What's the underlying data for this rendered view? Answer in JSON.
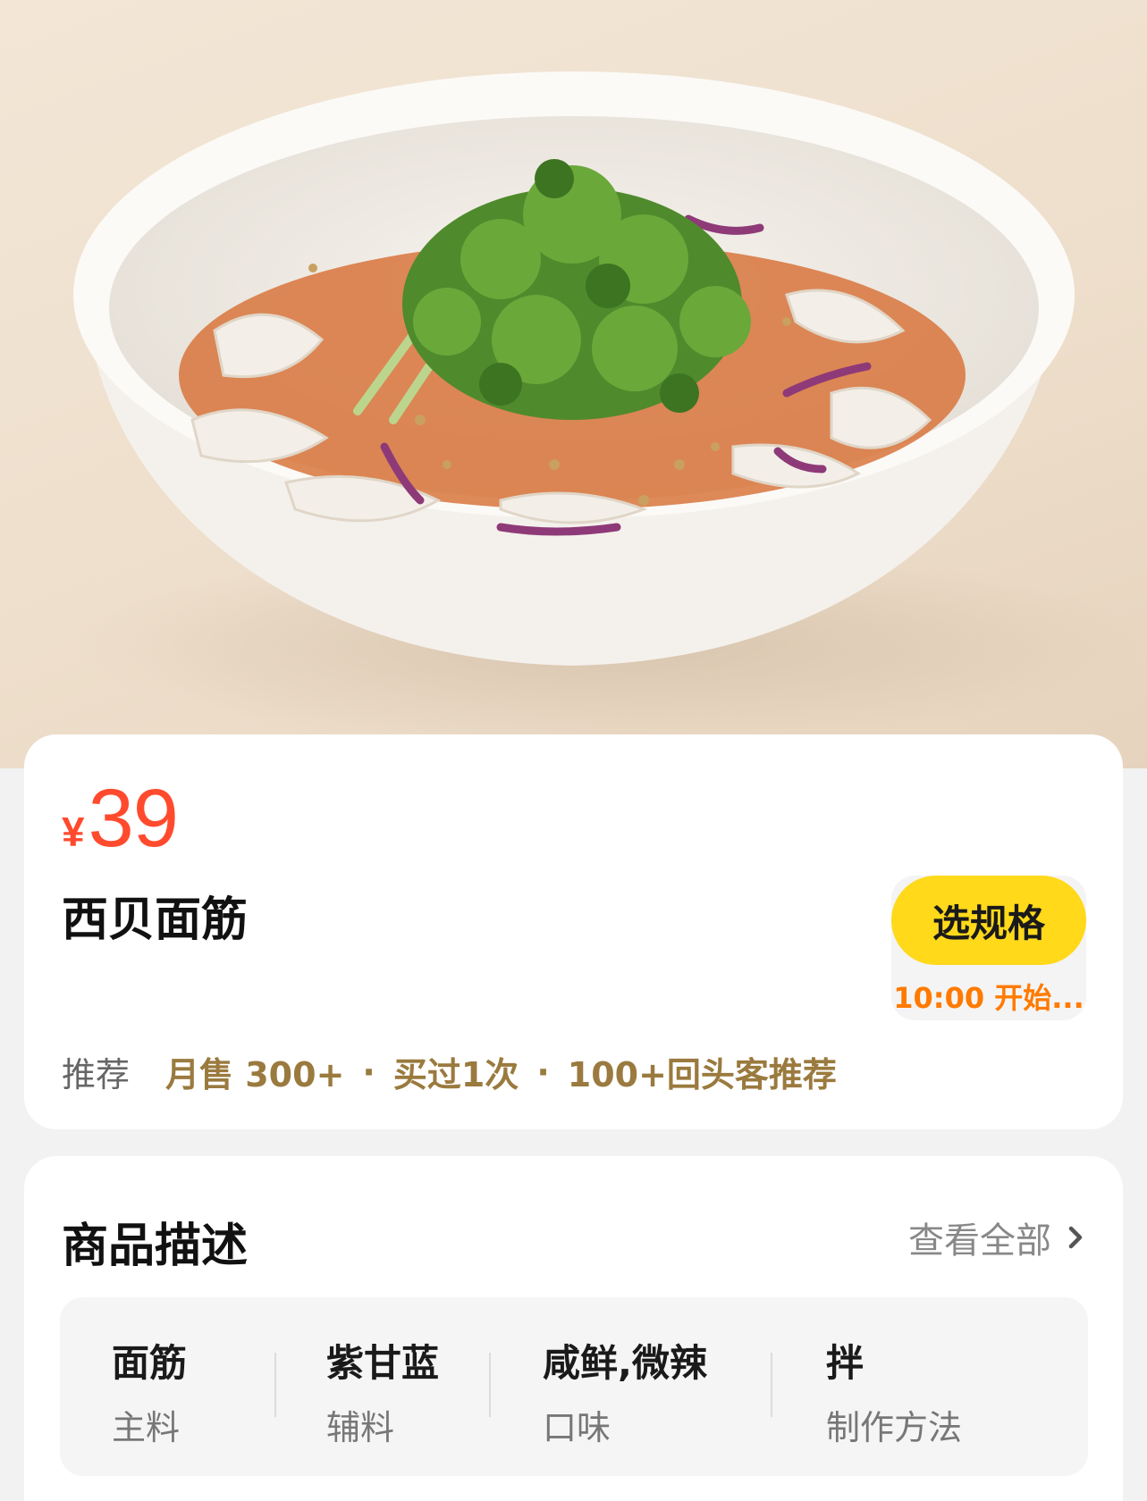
{
  "hero": {
    "image_desc": "dish photo"
  },
  "product": {
    "currency": "¥",
    "price": "39",
    "name": "西贝面筋",
    "spec_button": "选规格",
    "start_time": "10:00 开始...",
    "rec_label": "推荐",
    "rec_items": [
      "月售 300+",
      "买过1次",
      "100+回头客推荐"
    ]
  },
  "description": {
    "title": "商品描述",
    "view_all": "查看全部",
    "attributes": [
      {
        "value": "面筋",
        "name": "主料"
      },
      {
        "value": "紫甘蓝",
        "name": "辅料"
      },
      {
        "value": "咸鲜,微辣",
        "name": "口味"
      },
      {
        "value": "拌",
        "name": "制作方法"
      }
    ]
  },
  "colors": {
    "price": "#ff4a2e",
    "spec_button_bg": "#ffd91a",
    "start_time": "#ff7a00",
    "rec_highlight": "#9a7a3e"
  }
}
